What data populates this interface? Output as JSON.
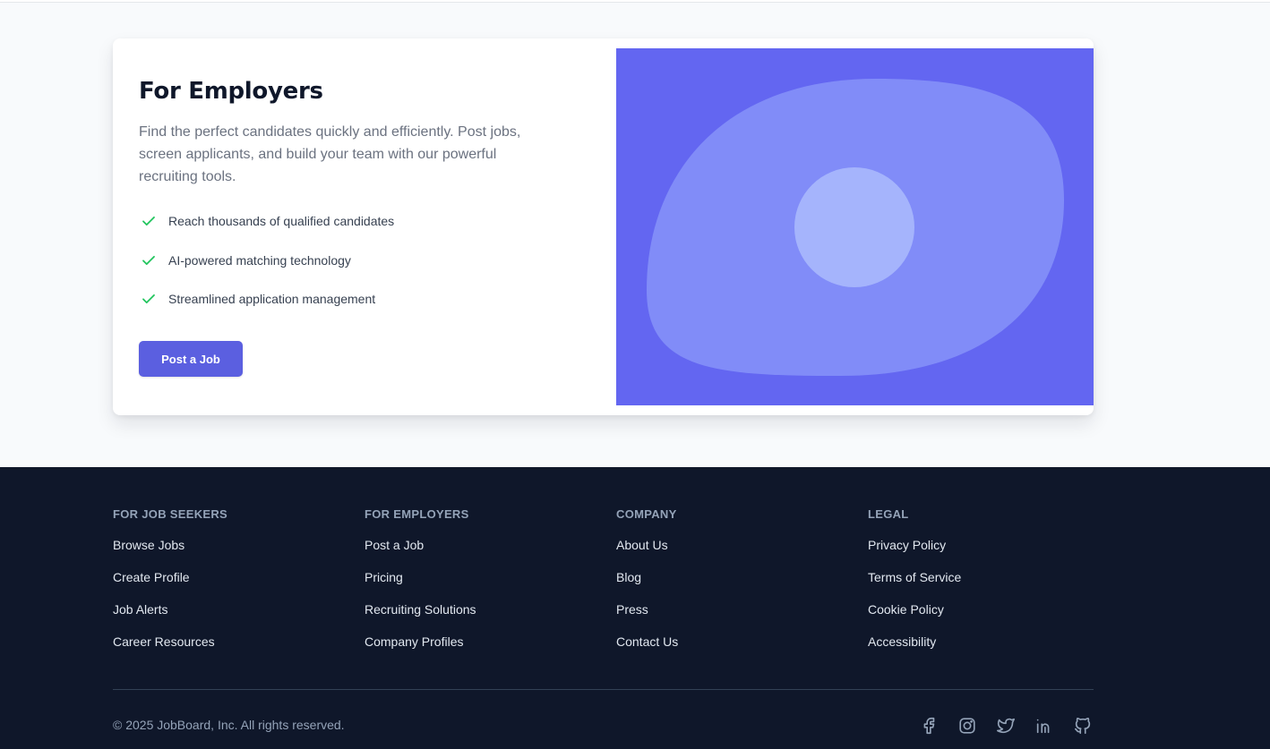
{
  "employers": {
    "title": "For Employers",
    "description": "Find the perfect candidates quickly and efficiently. Post jobs, screen applicants, and build your team with our powerful recruiting tools.",
    "features": [
      "Reach thousands of qualified candidates",
      "AI-powered matching technology",
      "Streamlined application management"
    ],
    "cta_label": "Post a Job",
    "check_icon": "check-icon",
    "colors": {
      "accent": "#6366f1",
      "button": "#5b5fe0",
      "check": "#22c55e",
      "blob": "#818cf8",
      "circle": "#a5b4fc"
    }
  },
  "footer": {
    "columns": [
      {
        "heading": "FOR JOB SEEKERS",
        "links": [
          "Browse Jobs",
          "Create Profile",
          "Job Alerts",
          "Career Resources"
        ]
      },
      {
        "heading": "FOR EMPLOYERS",
        "links": [
          "Post a Job",
          "Pricing",
          "Recruiting Solutions",
          "Company Profiles"
        ]
      },
      {
        "heading": "COMPANY",
        "links": [
          "About Us",
          "Blog",
          "Press",
          "Contact Us"
        ]
      },
      {
        "heading": "LEGAL",
        "links": [
          "Privacy Policy",
          "Terms of Service",
          "Cookie Policy",
          "Accessibility"
        ]
      }
    ],
    "copyright": "© 2025 JobBoard, Inc. All rights reserved.",
    "socials": [
      "facebook-icon",
      "instagram-icon",
      "twitter-icon",
      "linkedin-icon",
      "github-icon"
    ],
    "colors": {
      "background": "#0f172a",
      "heading": "#94a3b8",
      "link": "#e2e8f0"
    }
  }
}
